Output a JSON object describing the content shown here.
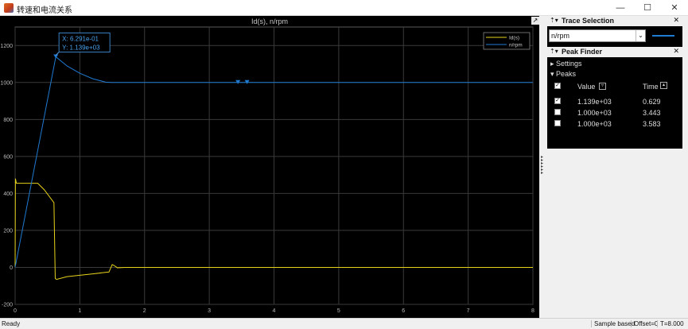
{
  "window": {
    "title": "转速和电流关系",
    "minimize": "—",
    "maximize": "☐",
    "close": "✕"
  },
  "plot": {
    "title": "Id(s), n/rpm",
    "dock_button": "↗"
  },
  "datatip": {
    "x_text": "X:  6.291e-01",
    "y_text": "Y:  1.139e+03"
  },
  "trace_selection": {
    "title": "Trace Selection",
    "selected": "n/rpm",
    "swatch_color": "#1f7ad2"
  },
  "peak_finder": {
    "title": "Peak Finder",
    "settings_label": "Settings",
    "peaks_label": "Peaks",
    "col_value": "Value",
    "col_time": "Time",
    "rows": [
      {
        "value": "1.139e+03",
        "time": "0.629",
        "checked": true
      },
      {
        "value": "1.000e+03",
        "time": "3.443",
        "checked": false
      },
      {
        "value": "1.000e+03",
        "time": "3.583",
        "checked": false
      }
    ]
  },
  "status": {
    "ready": "Ready",
    "mode": "Sample based",
    "offset": "Offset=0",
    "time": "T=8.000"
  },
  "chart_data": {
    "type": "line",
    "title": "Id(s), n/rpm",
    "xlim": [
      0,
      8
    ],
    "ylim": [
      -200,
      1300
    ],
    "x_ticks": [
      0,
      1,
      2,
      3,
      4,
      5,
      6,
      7,
      8
    ],
    "y_ticks": [
      -200,
      0,
      200,
      400,
      600,
      800,
      1000,
      1200
    ],
    "grid": true,
    "legend_position": "top-right",
    "series": [
      {
        "name": "Id(s)",
        "color": "#e6d21a",
        "x": [
          0,
          0.005,
          0.02,
          0.35,
          0.45,
          0.6,
          0.62,
          0.64,
          0.8,
          1.2,
          1.45,
          1.5,
          1.53,
          1.58,
          1.7,
          8
        ],
        "y": [
          0,
          480,
          455,
          455,
          420,
          350,
          -60,
          -65,
          -50,
          -35,
          -25,
          15,
          10,
          -2,
          0,
          0
        ]
      },
      {
        "name": "n/rpm",
        "color": "#1f7ad2",
        "x": [
          0,
          0.629,
          0.8,
          1.0,
          1.2,
          1.4,
          1.5,
          8
        ],
        "y": [
          0,
          1139,
          1090,
          1050,
          1020,
          1002,
          1000,
          1000
        ]
      }
    ],
    "peak_markers": [
      {
        "x": 0.629,
        "y": 1139
      },
      {
        "x": 3.443,
        "y": 1000
      },
      {
        "x": 3.583,
        "y": 1000
      }
    ]
  }
}
